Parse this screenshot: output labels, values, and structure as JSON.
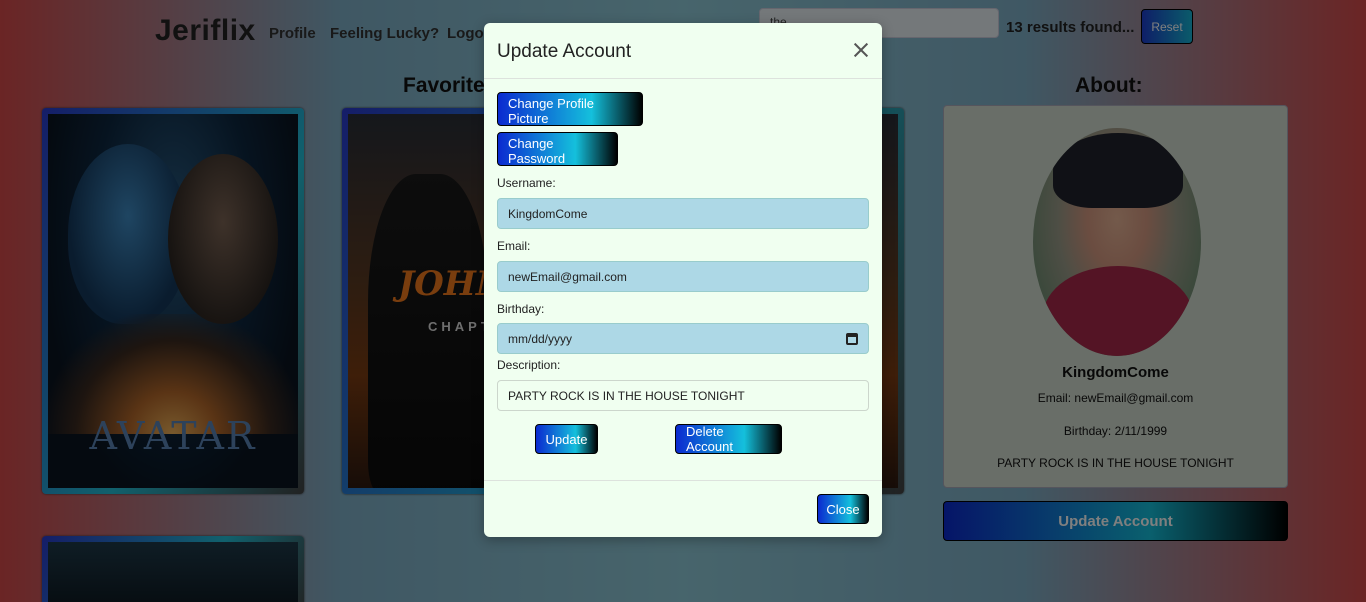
{
  "nav": {
    "brand": "Jeriflix",
    "links": [
      "Profile",
      "Feeling Lucky?",
      "Logo"
    ],
    "search_value": "the",
    "results": "13 results found...",
    "reset": "Reset"
  },
  "favorites": {
    "heading": "Favorite",
    "movies": [
      {
        "title": "AVATAR"
      },
      {
        "title": "JOHN W",
        "subtitle": "CHAPTE"
      },
      {
        "title": ""
      }
    ]
  },
  "about": {
    "heading": "About:",
    "username": "KingdomCome",
    "email": "Email: newEmail@gmail.com",
    "birthday": "Birthday: 2/11/1999",
    "description": "PARTY ROCK IS IN THE HOUSE TONIGHT",
    "update_button": "Update Account"
  },
  "modal": {
    "title": "Update Account",
    "change_picture": "Change Profile Picture",
    "change_password": "Change Password",
    "username_label": "Username:",
    "username_value": "KingdomCome",
    "email_label": "Email:",
    "email_value": "newEmail@gmail.com",
    "birthday_label": "Birthday:",
    "birthday_placeholder": "mm/dd/yyyy",
    "description_label": "Description:",
    "description_value": "PARTY ROCK IS IN THE HOUSE TONIGHT",
    "update": "Update",
    "delete": "Delete Account",
    "close": "Close"
  }
}
